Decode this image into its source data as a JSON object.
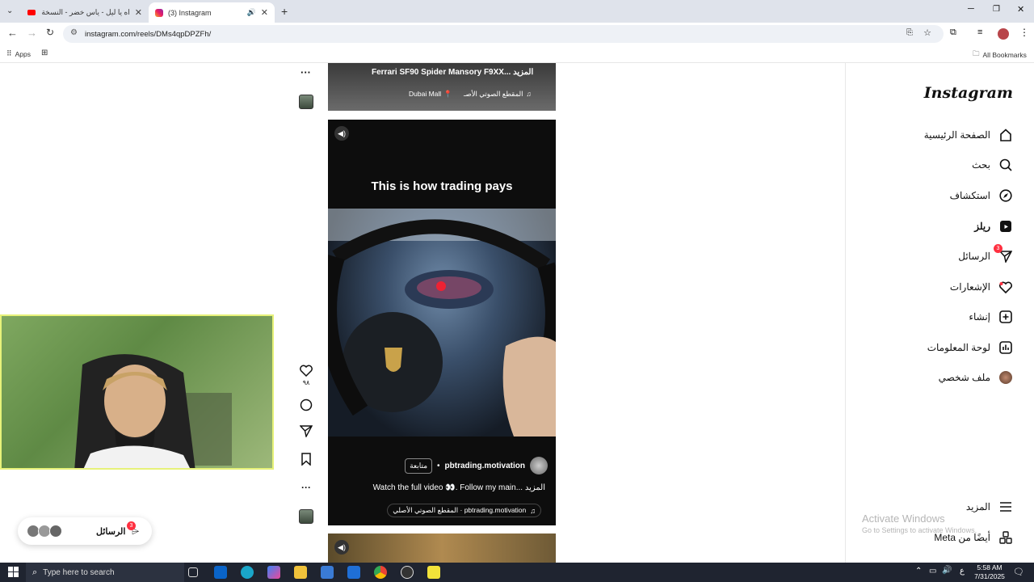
{
  "browser": {
    "tabs": [
      {
        "title": "اه يا ليل - ياس خضر - النسخة الا",
        "active": false
      },
      {
        "title": "(3) Instagram",
        "active": true
      }
    ],
    "url": "instagram.com/reels/DMs4qpDPZFh/",
    "bookmarks": {
      "apps": "Apps",
      "all": "All Bookmarks"
    }
  },
  "sidebar": {
    "logo": "Instagram",
    "items": [
      {
        "label": "الصفحة الرئيسية",
        "icon": "home-icon"
      },
      {
        "label": "بحث",
        "icon": "search-icon"
      },
      {
        "label": "استكشاف",
        "icon": "explore-icon"
      },
      {
        "label": "ريلز",
        "icon": "reels-icon"
      },
      {
        "label": "الرسائل",
        "icon": "messages-icon",
        "badge": "3"
      },
      {
        "label": "الإشعارات",
        "icon": "heart-icon"
      },
      {
        "label": "إنشاء",
        "icon": "create-icon"
      },
      {
        "label": "لوحة المعلومات",
        "icon": "dashboard-icon"
      },
      {
        "label": "ملف شخصي",
        "icon": "profile-icon"
      }
    ],
    "more": "المزيد",
    "meta": "أيضًا من Meta"
  },
  "prev_reel": {
    "caption": "Ferrari SF90 Spider Mansory F9XX... المزيد",
    "location": "Dubai Mall",
    "audio": "المقطع الصوتي الأصـ"
  },
  "reel": {
    "overlay_text": "This is how trading pays",
    "username": "pbtrading.motivation",
    "follow": "متابعة",
    "caption": "Watch the full video 👀. Follow my main... المزيد",
    "audio": "pbtrading.motivation · المقطع الصوتي الأصلي",
    "likes": "٩٨"
  },
  "messages_pill": {
    "label": "الرسائل",
    "badge": "3"
  },
  "watermark": {
    "title": "Activate Windows",
    "subtitle": "Go to Settings to activate Windows."
  },
  "taskbar": {
    "search": "Type here to search",
    "time": "5:58 AM",
    "date": "7/31/2025",
    "lang": "ع"
  }
}
